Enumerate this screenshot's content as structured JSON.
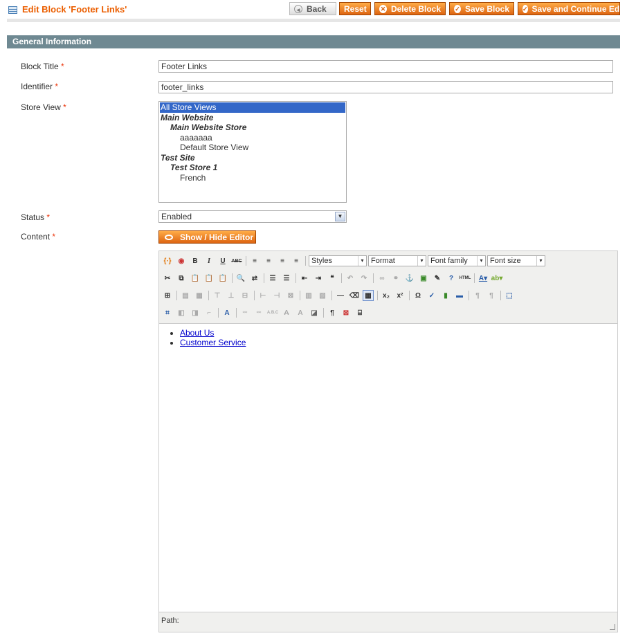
{
  "header": {
    "title": "Edit Block 'Footer Links'",
    "buttons": {
      "back": "Back",
      "reset": "Reset",
      "delete": "Delete Block",
      "save": "Save Block",
      "save_continue": "Save and Continue Edit"
    }
  },
  "section": {
    "title": "General Information"
  },
  "form": {
    "block_title": {
      "label": "Block Title",
      "required": "*",
      "value": "Footer Links"
    },
    "identifier": {
      "label": "Identifier",
      "required": "*",
      "value": "footer_links"
    },
    "store_view": {
      "label": "Store View",
      "required": "*",
      "options": [
        {
          "text": "All Store Views",
          "kind": "selected",
          "indent": 0
        },
        {
          "text": "Main Website",
          "kind": "group",
          "indent": 0
        },
        {
          "text": "Main Website Store",
          "kind": "group",
          "indent": 1
        },
        {
          "text": "aaaaaaa",
          "kind": "option",
          "indent": 2
        },
        {
          "text": "Default Store View",
          "kind": "option",
          "indent": 2
        },
        {
          "text": "Test Site",
          "kind": "group",
          "indent": 0
        },
        {
          "text": "Test Store 1",
          "kind": "group",
          "indent": 1
        },
        {
          "text": "French",
          "kind": "option",
          "indent": 2
        }
      ]
    },
    "status": {
      "label": "Status",
      "required": "*",
      "value": "Enabled"
    },
    "content": {
      "label": "Content",
      "required": "*",
      "toggle_label": "Show / Hide Editor"
    }
  },
  "editor": {
    "selects": {
      "styles": "Styles",
      "format": "Format",
      "font_family": "Font family",
      "font_size": "Font size"
    },
    "links": [
      "About Us",
      "Customer Service"
    ],
    "path_label": "Path:"
  },
  "colors": {
    "accent": "#eb5e00",
    "section_bar": "#6f8992",
    "selected": "#3367c8"
  }
}
